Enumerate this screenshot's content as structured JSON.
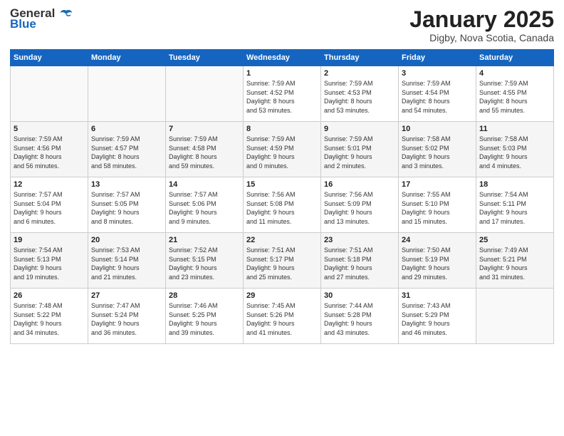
{
  "logo": {
    "line1": "General",
    "line2": "Blue"
  },
  "title": "January 2025",
  "subtitle": "Digby, Nova Scotia, Canada",
  "days_header": [
    "Sunday",
    "Monday",
    "Tuesday",
    "Wednesday",
    "Thursday",
    "Friday",
    "Saturday"
  ],
  "weeks": [
    [
      {
        "day": "",
        "info": ""
      },
      {
        "day": "",
        "info": ""
      },
      {
        "day": "",
        "info": ""
      },
      {
        "day": "1",
        "info": "Sunrise: 7:59 AM\nSunset: 4:52 PM\nDaylight: 8 hours\nand 53 minutes."
      },
      {
        "day": "2",
        "info": "Sunrise: 7:59 AM\nSunset: 4:53 PM\nDaylight: 8 hours\nand 53 minutes."
      },
      {
        "day": "3",
        "info": "Sunrise: 7:59 AM\nSunset: 4:54 PM\nDaylight: 8 hours\nand 54 minutes."
      },
      {
        "day": "4",
        "info": "Sunrise: 7:59 AM\nSunset: 4:55 PM\nDaylight: 8 hours\nand 55 minutes."
      }
    ],
    [
      {
        "day": "5",
        "info": "Sunrise: 7:59 AM\nSunset: 4:56 PM\nDaylight: 8 hours\nand 56 minutes."
      },
      {
        "day": "6",
        "info": "Sunrise: 7:59 AM\nSunset: 4:57 PM\nDaylight: 8 hours\nand 58 minutes."
      },
      {
        "day": "7",
        "info": "Sunrise: 7:59 AM\nSunset: 4:58 PM\nDaylight: 8 hours\nand 59 minutes."
      },
      {
        "day": "8",
        "info": "Sunrise: 7:59 AM\nSunset: 4:59 PM\nDaylight: 9 hours\nand 0 minutes."
      },
      {
        "day": "9",
        "info": "Sunrise: 7:59 AM\nSunset: 5:01 PM\nDaylight: 9 hours\nand 2 minutes."
      },
      {
        "day": "10",
        "info": "Sunrise: 7:58 AM\nSunset: 5:02 PM\nDaylight: 9 hours\nand 3 minutes."
      },
      {
        "day": "11",
        "info": "Sunrise: 7:58 AM\nSunset: 5:03 PM\nDaylight: 9 hours\nand 4 minutes."
      }
    ],
    [
      {
        "day": "12",
        "info": "Sunrise: 7:57 AM\nSunset: 5:04 PM\nDaylight: 9 hours\nand 6 minutes."
      },
      {
        "day": "13",
        "info": "Sunrise: 7:57 AM\nSunset: 5:05 PM\nDaylight: 9 hours\nand 8 minutes."
      },
      {
        "day": "14",
        "info": "Sunrise: 7:57 AM\nSunset: 5:06 PM\nDaylight: 9 hours\nand 9 minutes."
      },
      {
        "day": "15",
        "info": "Sunrise: 7:56 AM\nSunset: 5:08 PM\nDaylight: 9 hours\nand 11 minutes."
      },
      {
        "day": "16",
        "info": "Sunrise: 7:56 AM\nSunset: 5:09 PM\nDaylight: 9 hours\nand 13 minutes."
      },
      {
        "day": "17",
        "info": "Sunrise: 7:55 AM\nSunset: 5:10 PM\nDaylight: 9 hours\nand 15 minutes."
      },
      {
        "day": "18",
        "info": "Sunrise: 7:54 AM\nSunset: 5:11 PM\nDaylight: 9 hours\nand 17 minutes."
      }
    ],
    [
      {
        "day": "19",
        "info": "Sunrise: 7:54 AM\nSunset: 5:13 PM\nDaylight: 9 hours\nand 19 minutes."
      },
      {
        "day": "20",
        "info": "Sunrise: 7:53 AM\nSunset: 5:14 PM\nDaylight: 9 hours\nand 21 minutes."
      },
      {
        "day": "21",
        "info": "Sunrise: 7:52 AM\nSunset: 5:15 PM\nDaylight: 9 hours\nand 23 minutes."
      },
      {
        "day": "22",
        "info": "Sunrise: 7:51 AM\nSunset: 5:17 PM\nDaylight: 9 hours\nand 25 minutes."
      },
      {
        "day": "23",
        "info": "Sunrise: 7:51 AM\nSunset: 5:18 PM\nDaylight: 9 hours\nand 27 minutes."
      },
      {
        "day": "24",
        "info": "Sunrise: 7:50 AM\nSunset: 5:19 PM\nDaylight: 9 hours\nand 29 minutes."
      },
      {
        "day": "25",
        "info": "Sunrise: 7:49 AM\nSunset: 5:21 PM\nDaylight: 9 hours\nand 31 minutes."
      }
    ],
    [
      {
        "day": "26",
        "info": "Sunrise: 7:48 AM\nSunset: 5:22 PM\nDaylight: 9 hours\nand 34 minutes."
      },
      {
        "day": "27",
        "info": "Sunrise: 7:47 AM\nSunset: 5:24 PM\nDaylight: 9 hours\nand 36 minutes."
      },
      {
        "day": "28",
        "info": "Sunrise: 7:46 AM\nSunset: 5:25 PM\nDaylight: 9 hours\nand 39 minutes."
      },
      {
        "day": "29",
        "info": "Sunrise: 7:45 AM\nSunset: 5:26 PM\nDaylight: 9 hours\nand 41 minutes."
      },
      {
        "day": "30",
        "info": "Sunrise: 7:44 AM\nSunset: 5:28 PM\nDaylight: 9 hours\nand 43 minutes."
      },
      {
        "day": "31",
        "info": "Sunrise: 7:43 AM\nSunset: 5:29 PM\nDaylight: 9 hours\nand 46 minutes."
      },
      {
        "day": "",
        "info": ""
      }
    ]
  ]
}
